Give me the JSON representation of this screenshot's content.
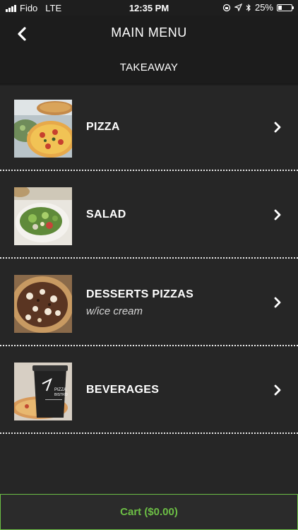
{
  "status_bar": {
    "carrier": "Fido",
    "network": "LTE",
    "time": "12:35 PM",
    "battery": "25%",
    "battery_level": 0.25
  },
  "header": {
    "title": "MAIN MENU",
    "subtitle": "TAKEAWAY"
  },
  "menu": {
    "items": [
      {
        "label": "PIZZA",
        "sublabel": "",
        "image_icon": "pizza-photo"
      },
      {
        "label": "SALAD",
        "sublabel": "",
        "image_icon": "salad-photo"
      },
      {
        "label": "DESSERTS PIZZAS",
        "sublabel": "w/ice cream",
        "image_icon": "dessert-pizza-photo"
      },
      {
        "label": "BEVERAGES",
        "sublabel": "",
        "image_icon": "beverage-cup-photo"
      }
    ]
  },
  "cart": {
    "label": "Cart ($0.00)"
  },
  "colors": {
    "accent": "#6cbe45",
    "background": "#262626",
    "header": "#1c1c1c"
  }
}
